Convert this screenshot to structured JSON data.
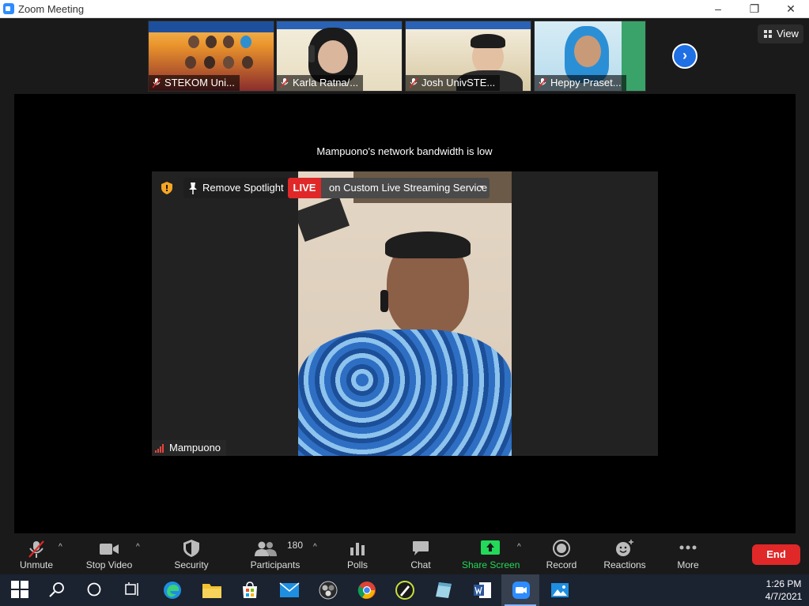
{
  "window": {
    "title": "Zoom Meeting"
  },
  "gallery": {
    "thumbnails": [
      {
        "name": "STEKOM Uni...",
        "muted": true
      },
      {
        "name": "Karla Ratna/...",
        "muted": true
      },
      {
        "name": "Josh UnivSTE...",
        "muted": true
      },
      {
        "name": "Heppy Praset...",
        "muted": true
      }
    ],
    "view_label": "View"
  },
  "stage": {
    "notice": "Mampuono's network bandwidth is low",
    "spotlight_label": "Remove Spotlight",
    "live_badge": "LIVE",
    "live_service": "on Custom Live Streaming Service",
    "speaker_name": "Mampuono"
  },
  "toolbar": {
    "unmute": "Unmute",
    "stop_video": "Stop Video",
    "security": "Security",
    "participants": "Participants",
    "participant_count": "180",
    "polls": "Polls",
    "chat": "Chat",
    "share_screen": "Share Screen",
    "record": "Record",
    "reactions": "Reactions",
    "more": "More",
    "end": "End"
  },
  "colors": {
    "accent_blue": "#1f6fe5",
    "end_red": "#e02828",
    "share_green": "#23d959"
  },
  "taskbar": {
    "time": "1:26 PM",
    "date": "4/7/2021"
  }
}
